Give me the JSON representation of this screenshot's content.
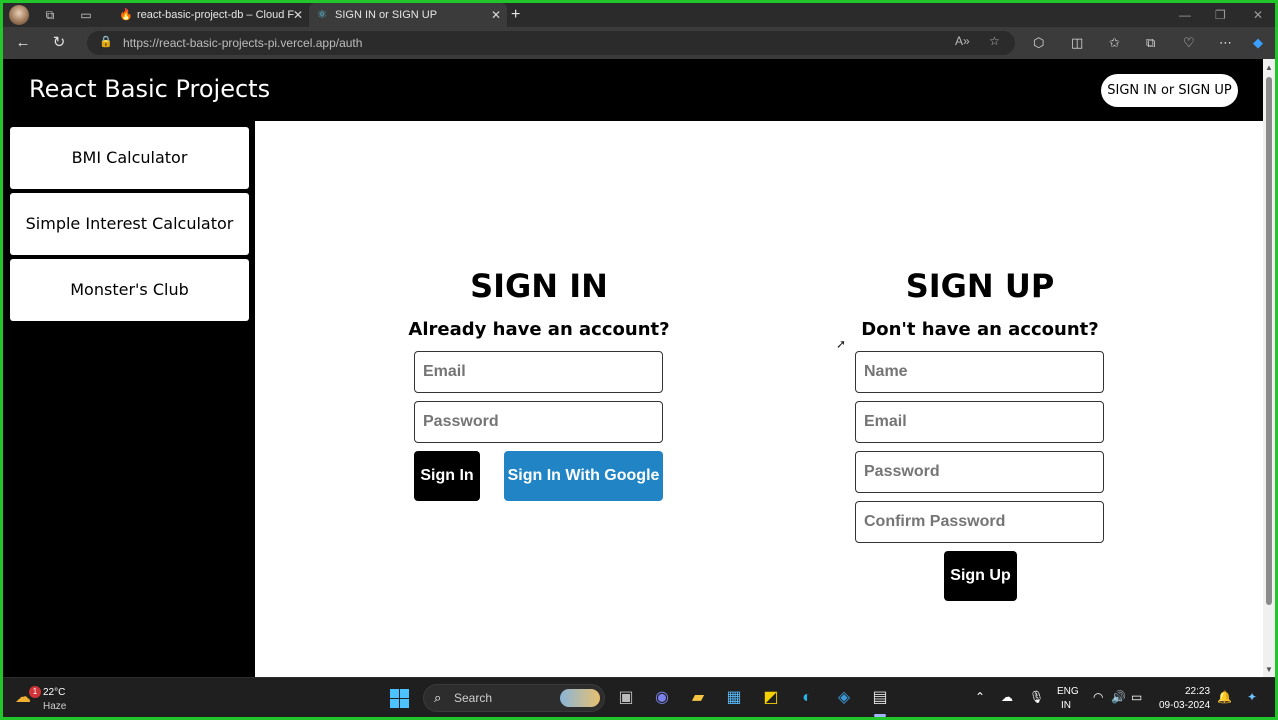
{
  "browser": {
    "tabs": [
      {
        "title": "react-basic-project-db – Cloud F",
        "favicon": "firebase-icon",
        "active": false
      },
      {
        "title": "SIGN IN or SIGN UP",
        "favicon": "react-icon",
        "active": true
      }
    ],
    "url": "https://react-basic-projects-pi.vercel.app/auth"
  },
  "app": {
    "title": "React Basic Projects",
    "auth_button": "SIGN IN or SIGN UP",
    "sidebar": {
      "items": [
        {
          "label": "BMI Calculator"
        },
        {
          "label": "Simple Interest Calculator"
        },
        {
          "label": "Monster's Club"
        }
      ]
    },
    "signin": {
      "title": "SIGN IN",
      "subtitle": "Already have an account?",
      "email_placeholder": "Email",
      "password_placeholder": "Password",
      "submit_label": "Sign In",
      "google_label": "Sign In With Google"
    },
    "signup": {
      "title": "SIGN UP",
      "subtitle": "Don't have an account?",
      "name_placeholder": "Name",
      "email_placeholder": "Email",
      "password_placeholder": "Password",
      "confirm_placeholder": "Confirm Password",
      "submit_label": "Sign Up"
    }
  },
  "taskbar": {
    "weather": {
      "temp": "22°C",
      "desc": "Haze",
      "badge": "1"
    },
    "search_label": "Search",
    "language": {
      "line1": "ENG",
      "line2": "IN"
    },
    "time": "22:23",
    "date": "09-03-2024"
  },
  "colors": {
    "accent_blue": "#2185c5",
    "app_black": "#000000",
    "frame_green": "#22c52a"
  }
}
